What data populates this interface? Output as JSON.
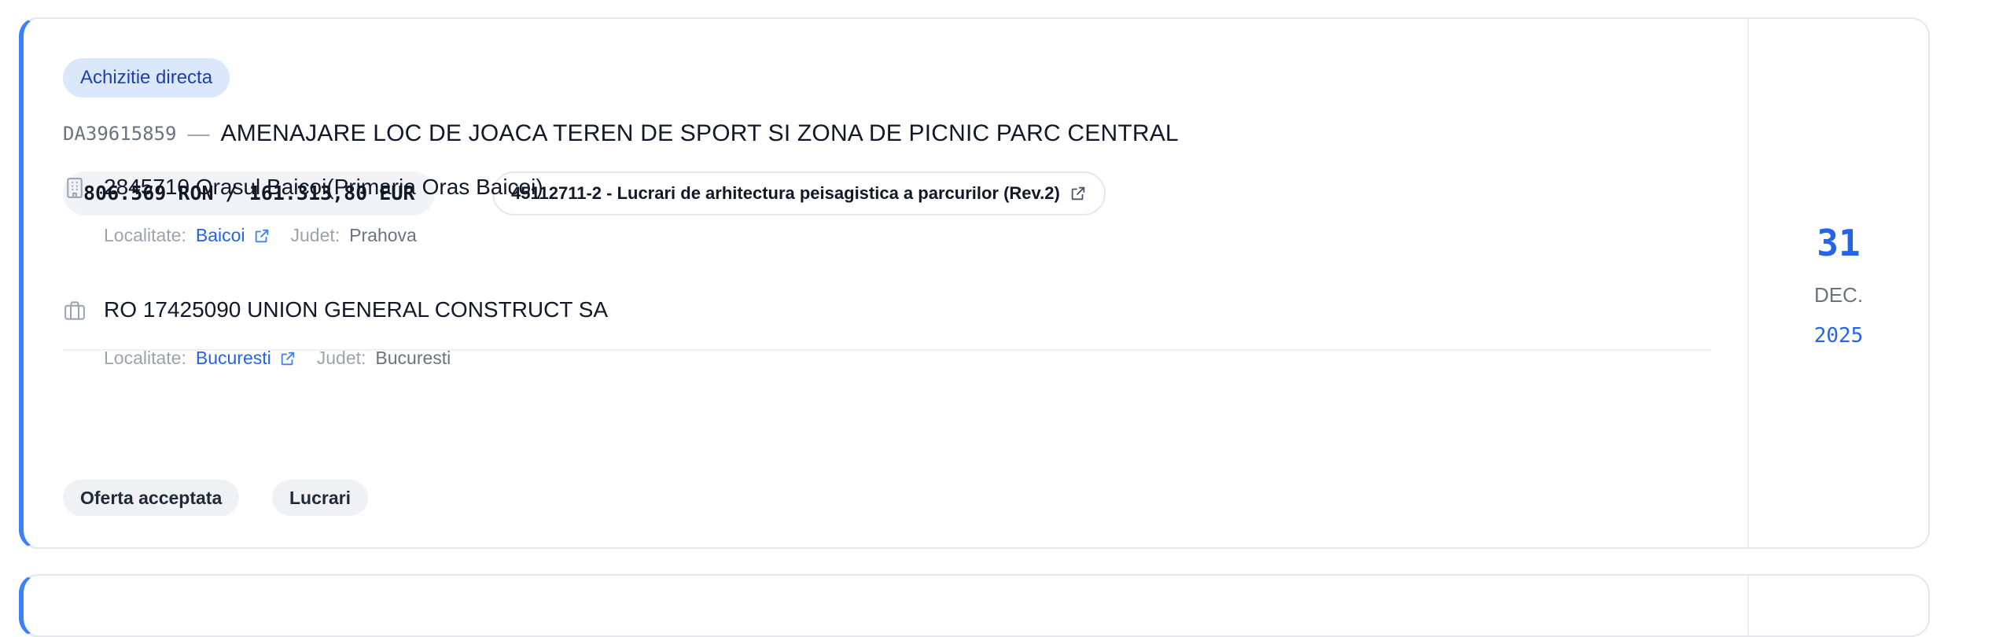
{
  "card": {
    "procedure_type": "Achizitie directa",
    "code": "DA39615859",
    "separator": "—",
    "title": "AMENAJARE LOC DE JOACA TEREN DE SPORT SI ZONA DE PICNIC PARC CENTRAL",
    "price": "806.569 RON / 161.313,80 EUR",
    "cpv": "45112711-2 - Lucrari de arhitectura peisagistica a parcurilor (Rev.2)",
    "authority": {
      "icon": "building-icon",
      "name": "2845710 Orasul Baicoi(Primaria Oras Baicoi)",
      "locality_label": "Localitate:",
      "locality": "Baicoi",
      "county_label": "Judet:",
      "county": "Prahova"
    },
    "supplier": {
      "icon": "briefcase-icon",
      "name": "RO 17425090 UNION GENERAL CONSTRUCT SA",
      "locality_label": "Localitate:",
      "locality": "Bucuresti",
      "county_label": "Judet:",
      "county": "Bucuresti"
    },
    "tags": [
      "Oferta acceptata",
      "Lucrari"
    ],
    "date": {
      "day": "31",
      "month": "DEC.",
      "year": "2025"
    }
  },
  "colors": {
    "accent": "#3b82f6",
    "link": "#2563eb",
    "badge_bg": "#dbe8fb",
    "badge_text": "#1e40af",
    "border": "#e5e7eb"
  }
}
